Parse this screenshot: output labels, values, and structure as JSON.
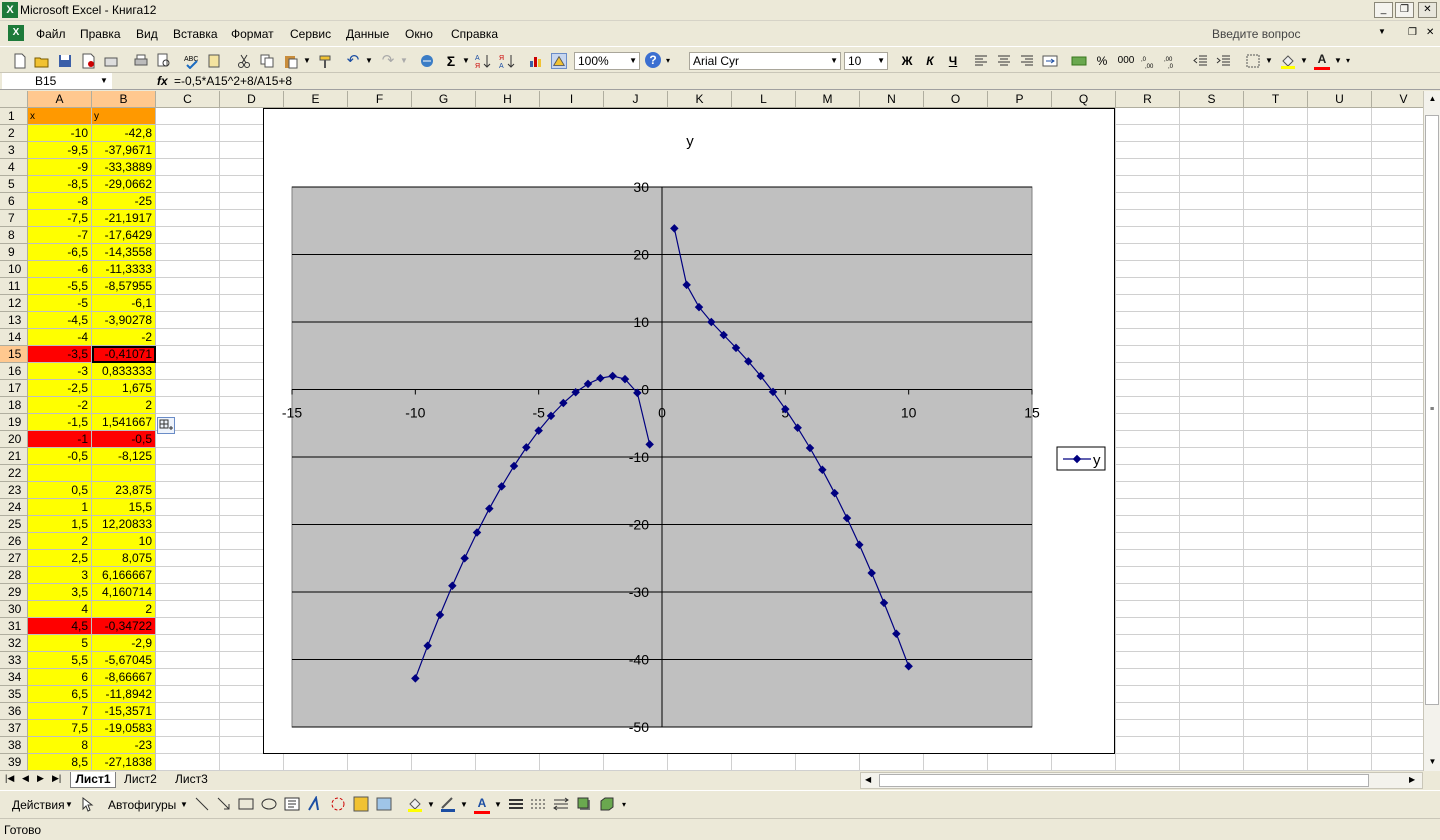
{
  "window": {
    "title": "Microsoft Excel - Книга12",
    "help_placeholder": "Введите вопрос"
  },
  "menu": [
    "Файл",
    "Правка",
    "Вид",
    "Вставка",
    "Формат",
    "Сервис",
    "Данные",
    "Окно",
    "Справка"
  ],
  "toolbar": {
    "zoom": "100%",
    "font": "Arial Cyr",
    "size": "10",
    "bold": "Ж",
    "italic": "К",
    "underline": "Ч",
    "percent": "%",
    "thousands": "000"
  },
  "formula_bar": {
    "name_box": "B15",
    "fx": "fx",
    "formula": "=-0,5*A15^2+8/A15+8"
  },
  "columns": [
    "A",
    "B",
    "C",
    "D",
    "E",
    "F",
    "G",
    "H",
    "I",
    "J",
    "K",
    "L",
    "M",
    "N",
    "O",
    "P",
    "Q",
    "R",
    "S",
    "T",
    "U",
    "V"
  ],
  "rows": [
    {
      "n": "1",
      "a": "x",
      "b": "y",
      "s": "o"
    },
    {
      "n": "2",
      "a": "-10",
      "b": "-42,8",
      "s": "y"
    },
    {
      "n": "3",
      "a": "-9,5",
      "b": "-37,9671",
      "s": "y"
    },
    {
      "n": "4",
      "a": "-9",
      "b": "-33,3889",
      "s": "y"
    },
    {
      "n": "5",
      "a": "-8,5",
      "b": "-29,0662",
      "s": "y"
    },
    {
      "n": "6",
      "a": "-8",
      "b": "-25",
      "s": "y"
    },
    {
      "n": "7",
      "a": "-7,5",
      "b": "-21,1917",
      "s": "y"
    },
    {
      "n": "8",
      "a": "-7",
      "b": "-17,6429",
      "s": "y"
    },
    {
      "n": "9",
      "a": "-6,5",
      "b": "-14,3558",
      "s": "y"
    },
    {
      "n": "10",
      "a": "-6",
      "b": "-11,3333",
      "s": "y"
    },
    {
      "n": "11",
      "a": "-5,5",
      "b": "-8,57955",
      "s": "y"
    },
    {
      "n": "12",
      "a": "-5",
      "b": "-6,1",
      "s": "y"
    },
    {
      "n": "13",
      "a": "-4,5",
      "b": "-3,90278",
      "s": "y"
    },
    {
      "n": "14",
      "a": "-4",
      "b": "-2",
      "s": "y"
    },
    {
      "n": "15",
      "a": "-3,5",
      "b": "-0,41071",
      "s": "r"
    },
    {
      "n": "16",
      "a": "-3",
      "b": "0,833333",
      "s": "y"
    },
    {
      "n": "17",
      "a": "-2,5",
      "b": "1,675",
      "s": "y"
    },
    {
      "n": "18",
      "a": "-2",
      "b": "2",
      "s": "y"
    },
    {
      "n": "19",
      "a": "-1,5",
      "b": "1,541667",
      "s": "y"
    },
    {
      "n": "20",
      "a": "-1",
      "b": "-0,5",
      "s": "r"
    },
    {
      "n": "21",
      "a": "-0,5",
      "b": "-8,125",
      "s": "y"
    },
    {
      "n": "22",
      "a": "",
      "b": "",
      "s": "y"
    },
    {
      "n": "23",
      "a": "0,5",
      "b": "23,875",
      "s": "y"
    },
    {
      "n": "24",
      "a": "1",
      "b": "15,5",
      "s": "y"
    },
    {
      "n": "25",
      "a": "1,5",
      "b": "12,20833",
      "s": "y"
    },
    {
      "n": "26",
      "a": "2",
      "b": "10",
      "s": "y"
    },
    {
      "n": "27",
      "a": "2,5",
      "b": "8,075",
      "s": "y"
    },
    {
      "n": "28",
      "a": "3",
      "b": "6,166667",
      "s": "y"
    },
    {
      "n": "29",
      "a": "3,5",
      "b": "4,160714",
      "s": "y"
    },
    {
      "n": "30",
      "a": "4",
      "b": "2",
      "s": "y"
    },
    {
      "n": "31",
      "a": "4,5",
      "b": "-0,34722",
      "s": "r"
    },
    {
      "n": "32",
      "a": "5",
      "b": "-2,9",
      "s": "y"
    },
    {
      "n": "33",
      "a": "5,5",
      "b": "-5,67045",
      "s": "y"
    },
    {
      "n": "34",
      "a": "6",
      "b": "-8,66667",
      "s": "y"
    },
    {
      "n": "35",
      "a": "6,5",
      "b": "-11,8942",
      "s": "y"
    },
    {
      "n": "36",
      "a": "7",
      "b": "-15,3571",
      "s": "y"
    },
    {
      "n": "37",
      "a": "7,5",
      "b": "-19,0583",
      "s": "y"
    },
    {
      "n": "38",
      "a": "8",
      "b": "-23",
      "s": "y"
    },
    {
      "n": "39",
      "a": "8,5",
      "b": "-27,1838",
      "s": "y"
    }
  ],
  "chart_data": {
    "type": "scatter",
    "title": "y",
    "legend": "y",
    "legend_position": "right",
    "xlim": [
      -15,
      15
    ],
    "ylim": [
      -50,
      30
    ],
    "x_ticks": [
      -15,
      -10,
      -5,
      0,
      5,
      10,
      15
    ],
    "y_ticks": [
      30,
      20,
      10,
      0,
      -10,
      -20,
      -30,
      -40,
      -50
    ],
    "grid": true,
    "plot_bg": "#c0c0c0",
    "series_color": "#000080",
    "series": [
      {
        "name": "y",
        "x": [
          -10,
          -9.5,
          -9,
          -8.5,
          -8,
          -7.5,
          -7,
          -6.5,
          -6,
          -5.5,
          -5,
          -4.5,
          -4,
          -3.5,
          -3,
          -2.5,
          -2,
          -1.5,
          -1,
          -0.5,
          null,
          0.5,
          1,
          1.5,
          2,
          2.5,
          3,
          3.5,
          4,
          4.5,
          5,
          5.5,
          6,
          6.5,
          7,
          7.5,
          8,
          8.5,
          9,
          9.5,
          10
        ],
        "y": [
          -42.8,
          -37.9671,
          -33.3889,
          -29.0662,
          -25,
          -21.1917,
          -17.6429,
          -14.3558,
          -11.3333,
          -8.57955,
          -6.1,
          -3.90278,
          -2,
          -0.41071,
          0.833333,
          1.675,
          2,
          1.541667,
          -0.5,
          -8.125,
          null,
          23.875,
          15.5,
          12.20833,
          10,
          8.075,
          6.166667,
          4.160714,
          2,
          -0.34722,
          -2.9,
          -5.67045,
          -8.66667,
          -11.8942,
          -15.3571,
          -19.0583,
          -23,
          -27.1838,
          -31.6111,
          -36.1921,
          -41
        ]
      }
    ]
  },
  "sheets": [
    "Лист1",
    "Лист2",
    "Лист3"
  ],
  "drawing": {
    "actions": "Действия",
    "autoshapes": "Автофигуры"
  },
  "status": "Готово"
}
